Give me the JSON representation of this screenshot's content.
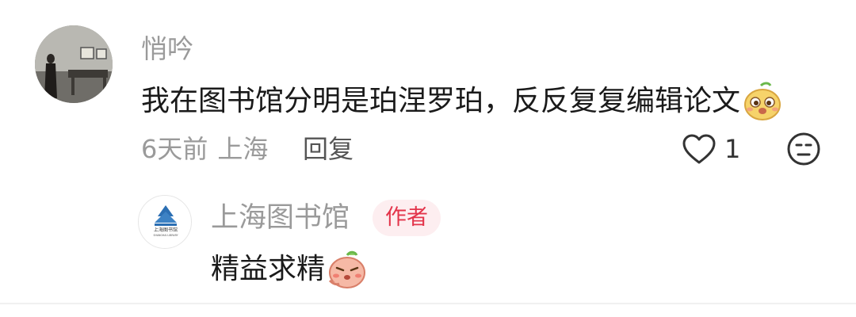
{
  "comment": {
    "username": "悄吟",
    "text": "我在图书馆分明是珀涅罗珀，反反复复编辑论文",
    "emoji": "face-emoji",
    "time": "6天前",
    "location": "上海",
    "reply_label": "回复",
    "like_count": "1"
  },
  "reply": {
    "username": "上海图书馆",
    "badge": "作者",
    "text": "精益求精",
    "emoji": "peach-emoji",
    "logo_text": "上海图书馆",
    "logo_subtext": "SHANGHAI LIBRARY"
  },
  "colors": {
    "badge_bg": "#fdeef0",
    "badge_text": "#e3344a",
    "meta_text": "#9a9a9a",
    "logo_blue": "#2c6fb3"
  }
}
